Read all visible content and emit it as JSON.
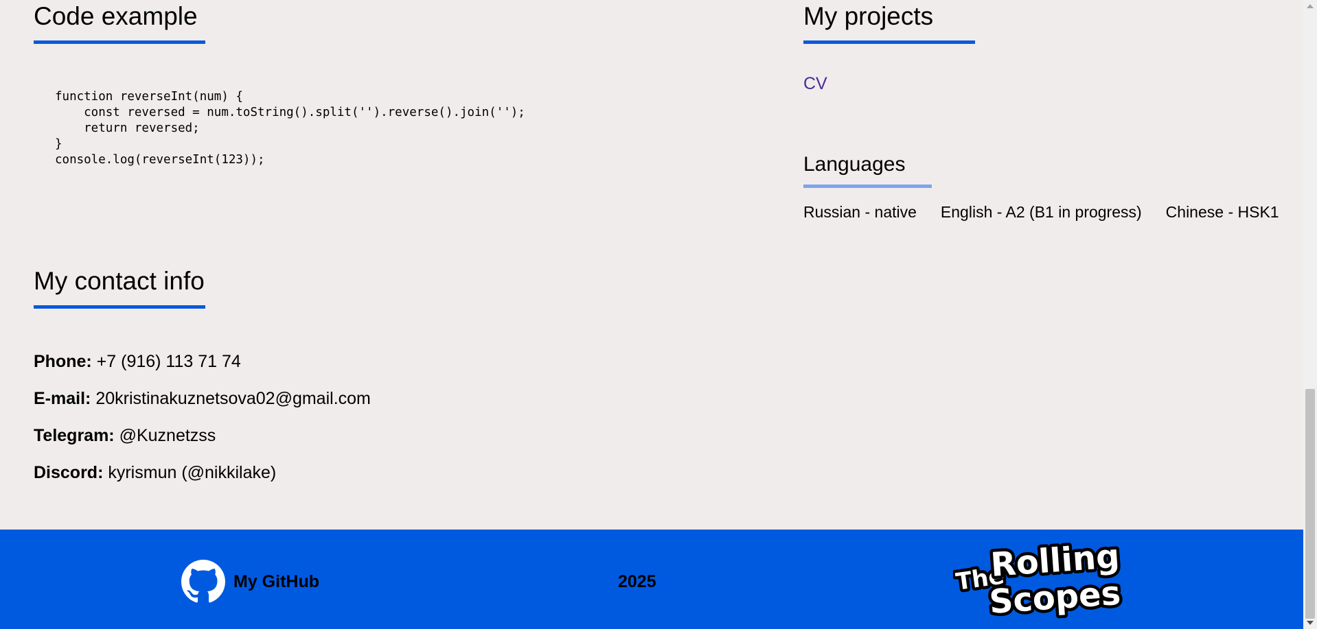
{
  "code_section": {
    "title": "Code example",
    "code": "function reverseInt(num) {\n    const reversed = num.toString().split('').reverse().join('');\n    return reversed;\n}\nconsole.log(reverseInt(123));"
  },
  "projects_section": {
    "title": "My projects",
    "links": [
      {
        "label": "CV"
      }
    ]
  },
  "languages_section": {
    "title": "Languages",
    "items": [
      "Russian - native",
      "English - A2 (B1 in progress)",
      "Chinese - HSK1"
    ]
  },
  "contact_section": {
    "title": "My contact info",
    "items": [
      {
        "label": "Phone:",
        "value": "+7 (916) 113 71 74"
      },
      {
        "label": "E-mail:",
        "value": "20kristinakuznetsova02@gmail.com"
      },
      {
        "label": "Telegram:",
        "value": "@Kuznetzss"
      },
      {
        "label": "Discord:",
        "value": "kyrismun (@nikkilake)"
      }
    ]
  },
  "footer": {
    "github_label": "My GitHub",
    "year": "2025",
    "logo_text": [
      "The",
      "Rolling",
      "Scopes"
    ]
  },
  "colors": {
    "background": "#f0ecec",
    "accent": "#0a59d9",
    "footer": "#005ae0",
    "link": "#4b2b99"
  }
}
